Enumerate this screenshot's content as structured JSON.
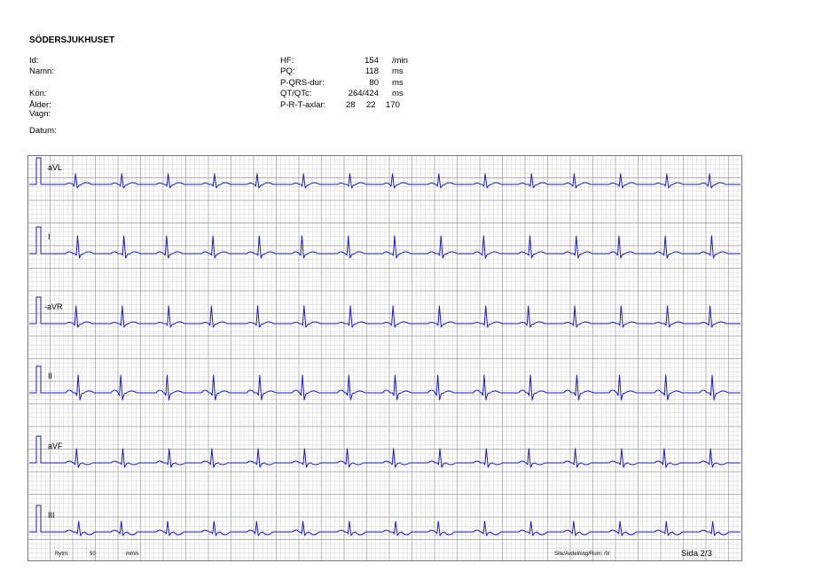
{
  "hospital": "SÖDERSJUKHUSET",
  "patient_fields": {
    "id": "Id:",
    "name": "Namn:",
    "sex": "Kön:",
    "age": "Ålder:",
    "ward": "Vagn:",
    "date": "Datum:"
  },
  "measurements": {
    "hr": {
      "label": "HF:",
      "value": "154",
      "unit": "/min"
    },
    "pq": {
      "label": "PQ:",
      "value": "118",
      "unit": "ms"
    },
    "pqrs": {
      "label": "P-QRS-dur:",
      "value": "80",
      "unit": "ms"
    },
    "qt": {
      "label": "QT/QTc:",
      "value": "264/424",
      "unit": "ms"
    },
    "axes": {
      "label": "P-R-T-axlar:",
      "p": "28",
      "r": "22",
      "t": "170"
    }
  },
  "leads": [
    "aVL",
    "I",
    "-aVR",
    "II",
    "aVF",
    "III"
  ],
  "footer": {
    "rytm_label": "Rytm:",
    "speed_value": "50",
    "speed_unit": "mm/s",
    "site": "Site/Avdelning/Rum: /0/",
    "page": "Sida 2/3"
  },
  "beats_per_lead": 15,
  "colors": {
    "grid_minor": "#d2d2d2",
    "grid_major": "#9a9a9a",
    "trace": "#1a1acc"
  }
}
